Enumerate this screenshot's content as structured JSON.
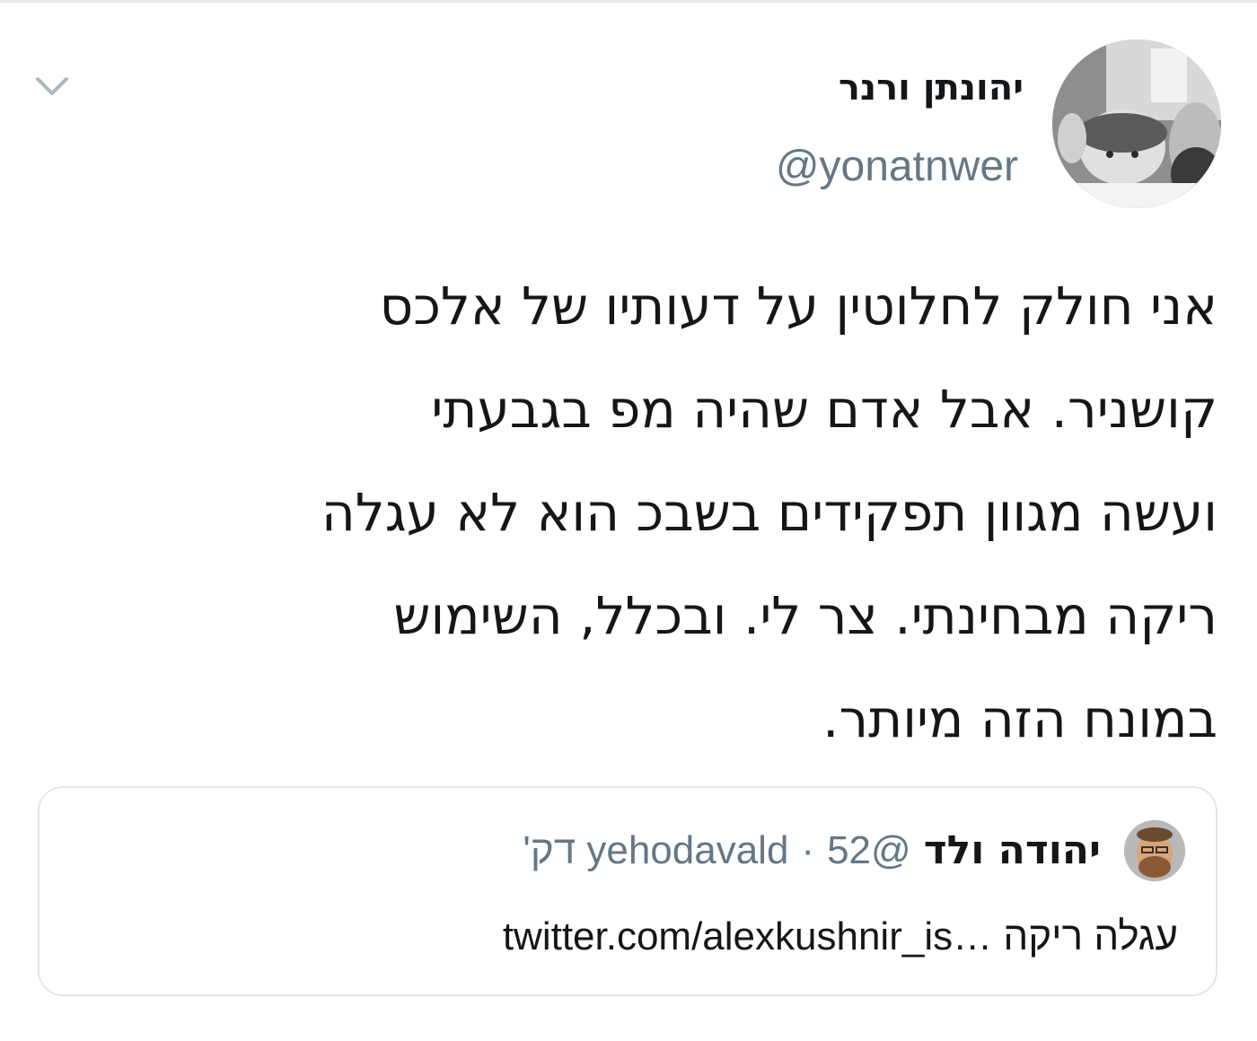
{
  "author": {
    "display_name": "יהונתן ורנר",
    "handle": "@yonatnwer"
  },
  "tweet": {
    "lines": [
      "אני חולק לחלוטין על דעותיו של אלכס",
      "קושניר. אבל אדם שהיה מפ בגבעתי",
      "ועשה מגוון תפקידים בשבכ הוא לא עגלה",
      "ריקה מבחינתי. צר לי. ובכלל,  השימוש",
      "במונח הזה מיותר."
    ]
  },
  "quoted_tweet": {
    "display_name": "יהודה ולד",
    "handle": "@yehodavald",
    "separator": "·",
    "time": "52 דק'",
    "text_prefix": "עגלה ריקה",
    "link": "twitter.com/alexkushnir_is…"
  },
  "icons": {
    "menu": "chevron-down-icon"
  },
  "colors": {
    "text": "#14171a",
    "secondary": "#657786",
    "border": "#e1e8ed"
  }
}
